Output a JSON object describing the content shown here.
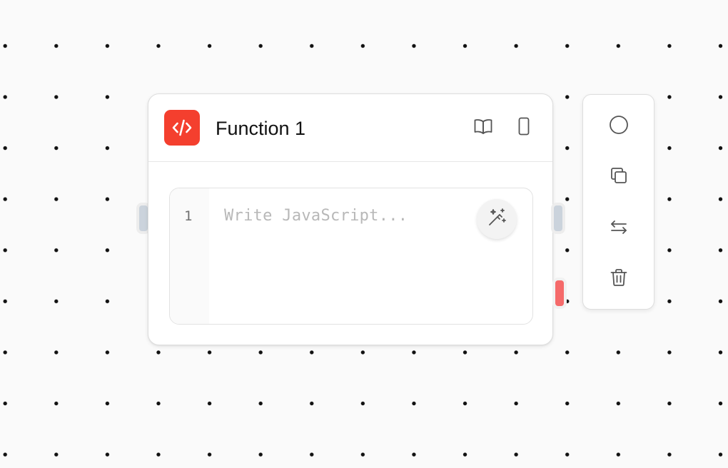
{
  "node": {
    "title": "Function 1",
    "icon": "code-icon",
    "accent_color": "#f43f2e",
    "header_actions": [
      {
        "name": "docs-button",
        "icon": "book-icon"
      },
      {
        "name": "mobile-button",
        "icon": "smartphone-icon"
      }
    ]
  },
  "editor": {
    "line_number": "1",
    "placeholder": "Write JavaScript...",
    "assist_button_icon": "magic-wand-icon"
  },
  "handles": {
    "input_color": "#cbd3dc",
    "output_color": "#cbd3dc",
    "error_color": "#f56a6a"
  },
  "toolbar": {
    "items": [
      {
        "name": "toggle-button",
        "icon": "circle-icon"
      },
      {
        "name": "duplicate-button",
        "icon": "copy-icon"
      },
      {
        "name": "swap-button",
        "icon": "swap-arrows-icon"
      },
      {
        "name": "delete-button",
        "icon": "trash-icon"
      }
    ]
  }
}
